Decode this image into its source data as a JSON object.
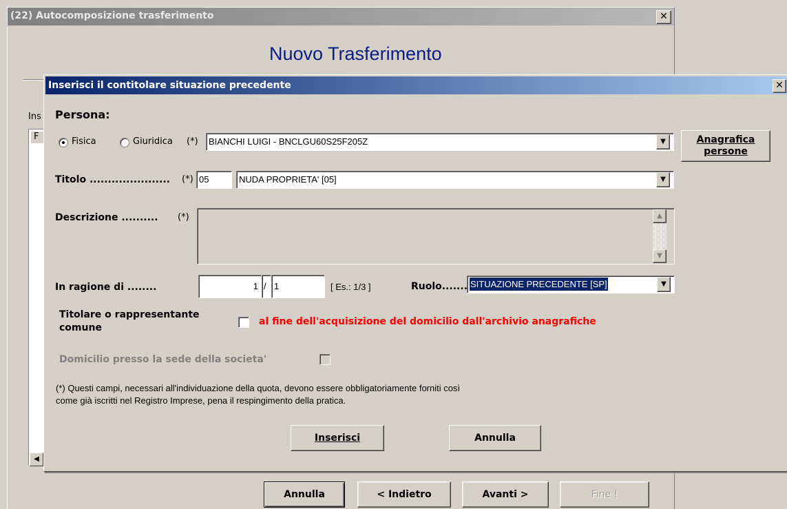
{
  "background_window": {
    "title": "(22) Autocomposizione trasferimento",
    "heading": "Nuovo Trasferimento",
    "list_label": "Ins",
    "list_header": "F",
    "buttons": {
      "annulla": "Annulla",
      "indietro": "< Indietro",
      "avanti": "Avanti >",
      "fine": "Fine !"
    }
  },
  "dialog": {
    "title": "Inserisci il contitolare situazione precedente",
    "persona_label": "Persona:",
    "radio_fisica": "Fisica",
    "radio_giuridica": "Giuridica",
    "required_mark": "(*)",
    "persona_value": "BIANCHI LUIGI - BNCLGU60S25F205Z",
    "anagrafica_button_line1": "Anagrafica",
    "anagrafica_button_line2": "persone",
    "titolo_label": "Titolo ......................",
    "titolo_code": "05",
    "titolo_value": "NUDA PROPRIETA' [05]",
    "descrizione_label": "Descrizione ..........",
    "descrizione_value": "",
    "ragione_label": "In ragione di ........",
    "ragione_num": "1",
    "ragione_sep": "/",
    "ragione_den": "1",
    "ragione_example": "[ Es.: 1/3 ]",
    "ruolo_label": "Ruolo.......",
    "ruolo_value": "SITUAZIONE PRECEDENTE [SP]",
    "titolare_label_line1": "Titolare o rappresentante",
    "titolare_label_line2": "comune",
    "titolare_note": "al fine dell'acquisizione del domicilio dall'archivio anagrafiche",
    "domicilio_label": "Domicilio presso la sede della societa'",
    "footnote_line1": "(*) Questi campi, necessari all'individuazione della quota, devono essere obbligatoriamente forniti così",
    "footnote_line2": "come già iscritti nel Registro Imprese, pena il respingimento della pratica.",
    "inserisci_button": "Inserisci",
    "annulla_button": "Annulla"
  },
  "colors": {
    "title_active": "#0a246a",
    "heading": "#0b1b8a",
    "note_red": "#ff0000",
    "disabled_text": "#808080"
  },
  "icons": {
    "close": "close-icon",
    "dropdown": "chevron-down-icon",
    "scroll_up": "scroll-up-icon",
    "scroll_down": "scroll-down-icon"
  }
}
